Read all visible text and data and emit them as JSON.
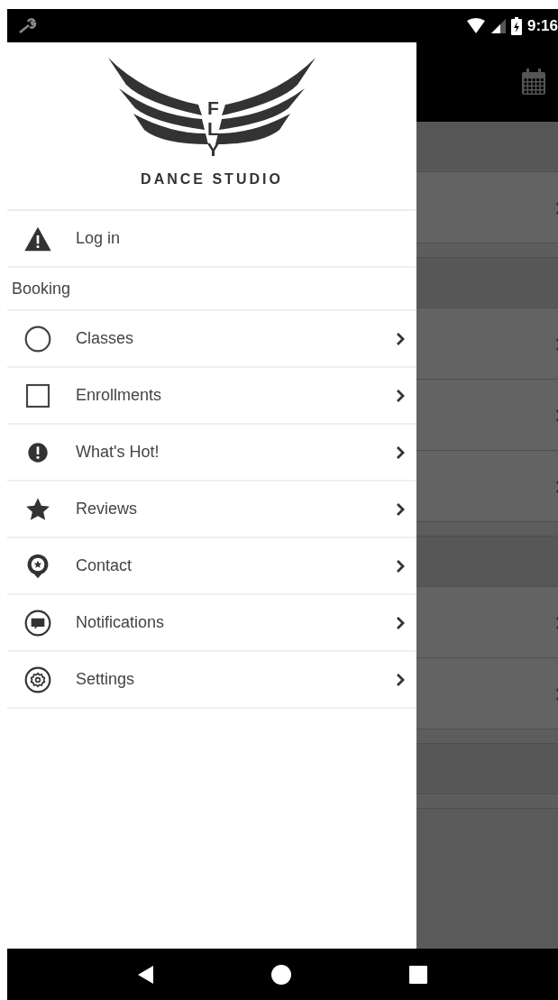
{
  "status_bar": {
    "time": "9:16"
  },
  "backdrop": {
    "rows": [
      {
        "kind": "header"
      },
      {
        "kind": "row"
      },
      {
        "kind": "gap"
      },
      {
        "kind": "header"
      },
      {
        "kind": "row"
      },
      {
        "kind": "row"
      },
      {
        "kind": "row"
      },
      {
        "kind": "gap"
      },
      {
        "kind": "header"
      },
      {
        "kind": "row"
      },
      {
        "kind": "row"
      },
      {
        "kind": "gap"
      },
      {
        "kind": "header"
      },
      {
        "kind": "gap"
      }
    ]
  },
  "drawer": {
    "logo": {
      "letters": "FLY",
      "subtitle": "DANCE STUDIO"
    },
    "login": {
      "label": "Log in"
    },
    "section": "Booking",
    "items": [
      {
        "label": "Classes",
        "kind": "circle"
      },
      {
        "label": "Enrollments",
        "kind": "square"
      },
      {
        "label": "What's Hot!",
        "kind": "alert"
      },
      {
        "label": "Reviews",
        "kind": "star"
      },
      {
        "label": "Contact",
        "kind": "pin"
      },
      {
        "label": "Notifications",
        "kind": "message"
      },
      {
        "label": "Settings",
        "kind": "gear"
      }
    ]
  }
}
